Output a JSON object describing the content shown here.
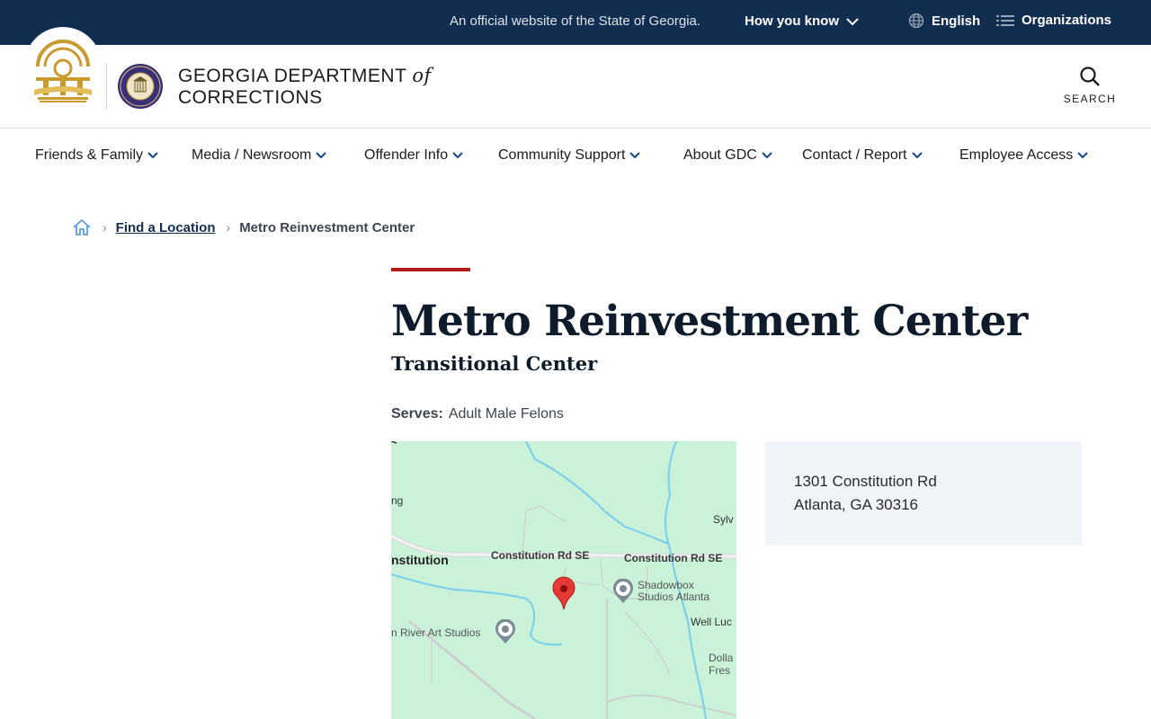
{
  "topbar": {
    "official_text": "An official website of the State of Georgia.",
    "how_you_know": "How you know",
    "language": "English",
    "organizations": "Organizations"
  },
  "header": {
    "agency_name_line1": "GEORGIA DEPARTMENT",
    "agency_name_of": "of",
    "agency_name_line2": "CORRECTIONS",
    "search_label": "SEARCH",
    "seal_text": "DEPARTMENT OF CORRECTIONS"
  },
  "nav": {
    "items": [
      {
        "label": "Friends & Family"
      },
      {
        "label": "Media / Newsroom"
      },
      {
        "label": "Offender Info"
      },
      {
        "label": "Community Support"
      },
      {
        "label": "About GDC"
      },
      {
        "label": "Contact / Report"
      },
      {
        "label": "Employee Access"
      }
    ]
  },
  "breadcrumb": {
    "link": "Find a Location",
    "current": "Metro Reinvestment Center"
  },
  "main": {
    "title": "Metro Reinvestment Center",
    "subtitle": "Transitional Center",
    "serves_label": "Serves:",
    "serves_value": "Adult Male Felons",
    "address_line1": "1301 Constitution Rd",
    "address_line2": "Atlanta, GA 30316"
  },
  "map": {
    "labels": {
      "ng": "ng",
      "sylv": "Sylv",
      "nstitution": "nstitution",
      "road1": "Constitution Rd SE",
      "road2": "Constitution Rd SE",
      "shadowbox1": "Shadowbox",
      "shadowbox2": "Studios Atlanta",
      "wellluc": "Well Luc",
      "river_art": "n River Art Studios",
      "dolla": "Dolla",
      "fres": "Fres"
    }
  },
  "colors": {
    "topbar_bg": "#112e51",
    "accent_red": "#b31b1b",
    "nav_chevron": "#1f4e8c",
    "map_green": "#c9f2d9",
    "map_water": "#7fd0ea",
    "pin_red": "#e53935"
  },
  "icons": [
    "globe-icon",
    "list-icon",
    "chevron-down-icon",
    "search-icon",
    "home-icon",
    "map-pin-icon",
    "poi-marker-icon"
  ]
}
